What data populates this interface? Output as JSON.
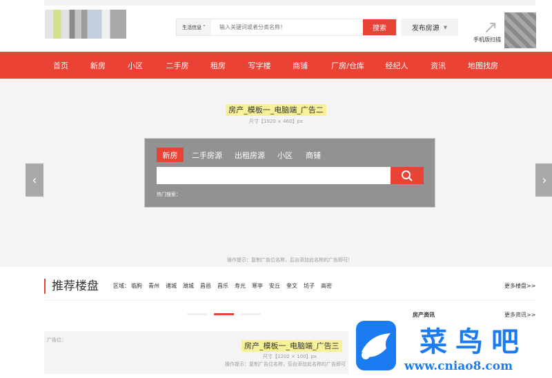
{
  "header": {
    "category": "生活信息",
    "search_placeholder": "输入关键词或者分类名称！",
    "search_button": "搜索",
    "publish": "发布房源",
    "mobile_scan": "手机版扫描"
  },
  "nav": [
    "首页",
    "新房",
    "小区",
    "二手房",
    "租房",
    "写字楼",
    "商铺",
    "厂房/仓库",
    "经纪人",
    "资讯",
    "地图找房"
  ],
  "banner": {
    "ad_label": "房产_模板一_电脑端_广告二",
    "ad_size": "尺寸【1920 × 460】px",
    "tip": "操作提示：复制广告位名称，后台添加此名称的广告即可！",
    "tabs": [
      "新房",
      "二手房源",
      "出租房源",
      "小区",
      "商铺"
    ],
    "hot_search": "热门搜索："
  },
  "section": {
    "title": "推荐楼盘",
    "area_label": "区域：",
    "areas": [
      "临朐",
      "青州",
      "诸城",
      "潍城",
      "昌邑",
      "昌乐",
      "寿光",
      "寒亭",
      "安丘",
      "奎文",
      "坊子",
      "高密"
    ],
    "more": "更多楼盘>>"
  },
  "news": {
    "title": "房产资讯",
    "more": "更多资讯>>"
  },
  "ad3": {
    "prefix": "广告位：",
    "label": "房产_模板一_电脑端_广告三",
    "size": "尺寸【1202 × 100】px",
    "tip": "操作提示：复制广告位名称，后台添加此名称的广告即可"
  },
  "watermark": {
    "name": "菜鸟吧",
    "url": "www.cniao8.com"
  },
  "colors": {
    "accent": "#ea4335",
    "watermark": "#1a7cf0"
  }
}
